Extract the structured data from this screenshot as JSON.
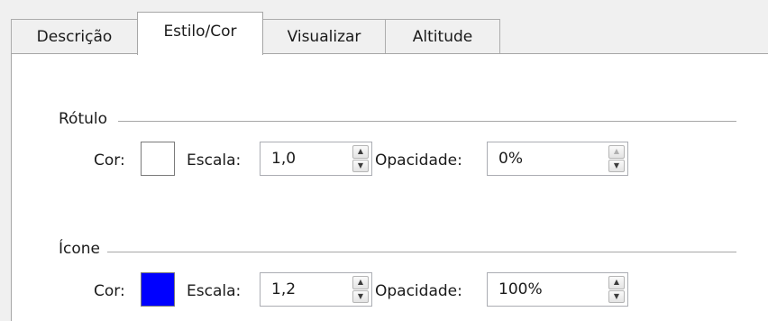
{
  "tabs": [
    {
      "label": "Descrição",
      "active": false
    },
    {
      "label": "Estilo/Cor",
      "active": true
    },
    {
      "label": "Visualizar",
      "active": false
    },
    {
      "label": "Altitude",
      "active": false
    }
  ],
  "label_group": {
    "title": "Rótulo",
    "color_label": "Cor:",
    "color": "#ffffff",
    "scale_label": "Escala:",
    "scale_value": "1,0",
    "opacity_label": "Opacidade:",
    "opacity_value": "0%"
  },
  "icon_group": {
    "title": "Ícone",
    "color_label": "Cor:",
    "color": "#0000ff",
    "scale_label": "Escala:",
    "scale_value": "1,2",
    "opacity_label": "Opacidade:",
    "opacity_value": "100%"
  },
  "icons": {
    "spin_up": "caret-up-icon",
    "spin_down": "caret-down-icon"
  }
}
